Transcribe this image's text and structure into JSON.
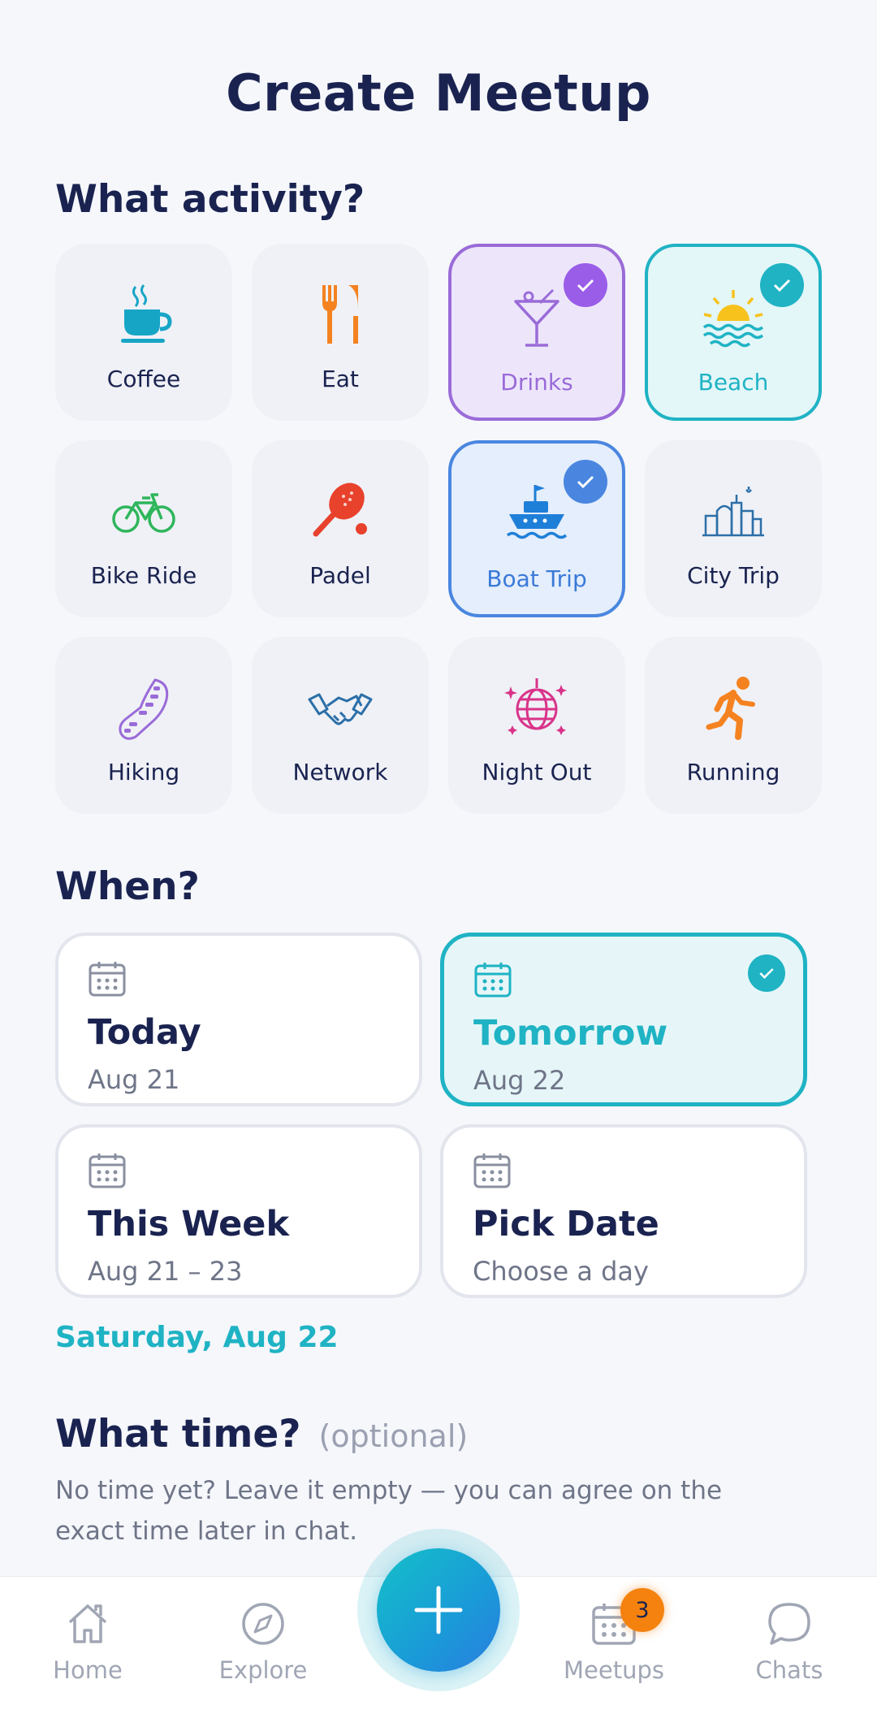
{
  "header": {
    "title": "Create Meetup"
  },
  "activity": {
    "title": "What activity?",
    "items": [
      {
        "label": "Coffee",
        "icon": "coffee-icon",
        "selected": false
      },
      {
        "label": "Eat",
        "icon": "utensils-icon",
        "selected": false
      },
      {
        "label": "Drinks",
        "icon": "cocktail-icon",
        "selected": true,
        "accent": "#9a6bd8"
      },
      {
        "label": "Beach",
        "icon": "sun-waves-icon",
        "selected": true,
        "accent": "#1fb3c4"
      },
      {
        "label": "Bike Ride",
        "icon": "bicycle-icon",
        "selected": false
      },
      {
        "label": "Padel",
        "icon": "padel-racket-icon",
        "selected": false
      },
      {
        "label": "Boat Trip",
        "icon": "ship-icon",
        "selected": true,
        "accent": "#4a86e0"
      },
      {
        "label": "City Trip",
        "icon": "city-skyline-icon",
        "selected": false
      },
      {
        "label": "Hiking",
        "icon": "footprint-icon",
        "selected": false
      },
      {
        "label": "Network",
        "icon": "handshake-icon",
        "selected": false
      },
      {
        "label": "Night Out",
        "icon": "disco-ball-icon",
        "selected": false
      },
      {
        "label": "Running",
        "icon": "runner-icon",
        "selected": false
      }
    ]
  },
  "when": {
    "title": "When?",
    "options": [
      {
        "title": "Today",
        "subtitle": "Aug 21",
        "selected": false
      },
      {
        "title": "Tomorrow",
        "subtitle": "Aug 22",
        "selected": true
      },
      {
        "title": "This Week",
        "subtitle": "Aug 21 – 23",
        "selected": false
      },
      {
        "title": "Pick Date",
        "subtitle": "Choose a day",
        "selected": false
      }
    ],
    "selected_date": "Saturday, Aug 22"
  },
  "time": {
    "title": "What time?",
    "optional": "(optional)",
    "hint": "No time yet? Leave it empty — you can agree on the exact time later in chat."
  },
  "nav": {
    "items": [
      {
        "label": "Home",
        "icon": "home-icon"
      },
      {
        "label": "Explore",
        "icon": "compass-icon"
      },
      {
        "label": "Meetups",
        "icon": "calendar-icon",
        "badge": "3"
      },
      {
        "label": "Chats",
        "icon": "chat-bubble-icon"
      }
    ],
    "fab_icon": "plus-icon"
  },
  "colors": {
    "primary_text": "#1a2350",
    "teal": "#1fb3c4",
    "purple": "#9a6bd8",
    "blue": "#4a86e0",
    "badge": "#f5820f"
  }
}
